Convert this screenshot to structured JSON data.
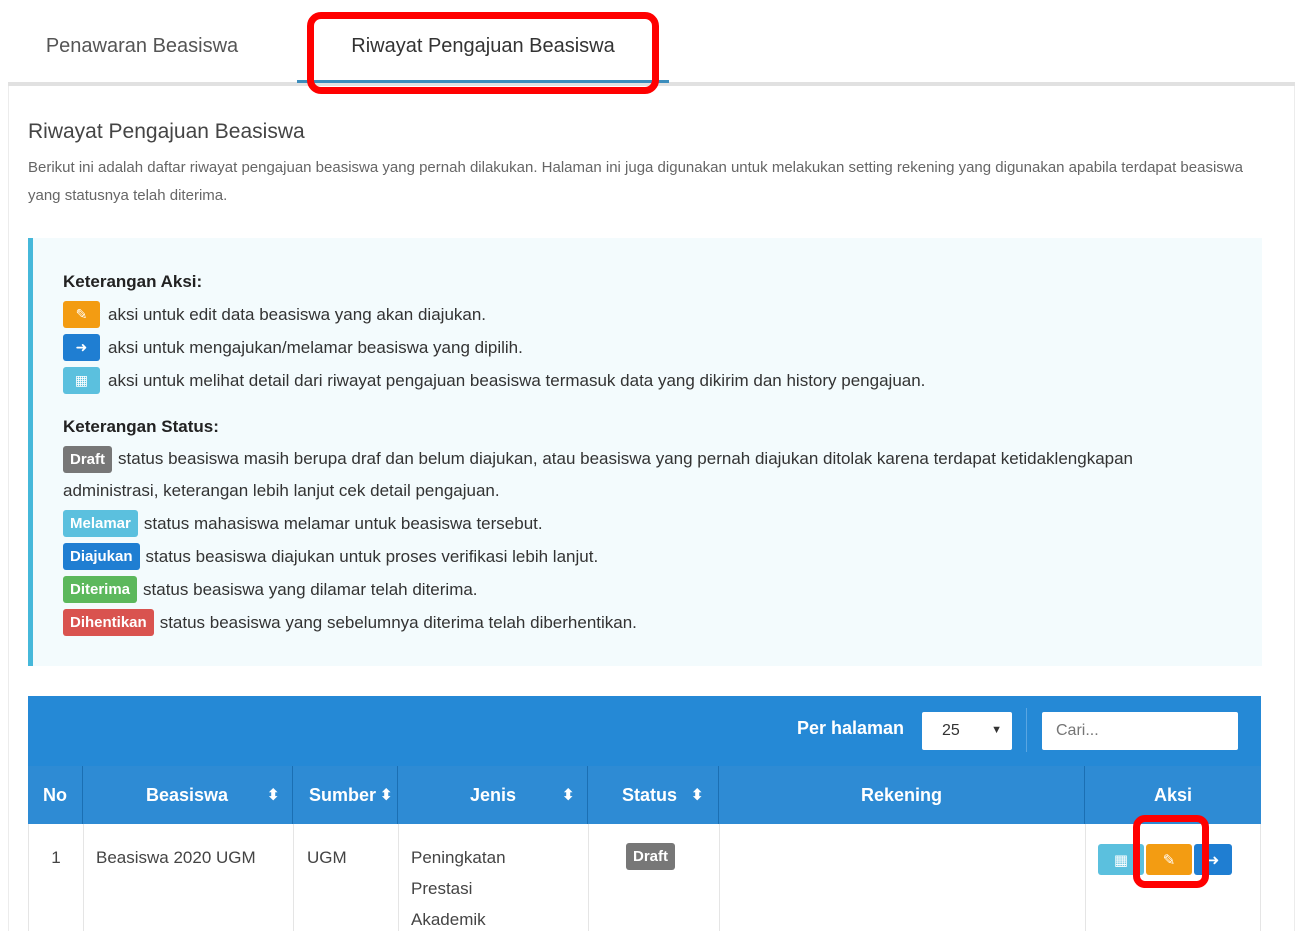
{
  "tabs": [
    {
      "label": "Penawaran Beasiswa"
    },
    {
      "label": "Riwayat Pengajuan Beasiswa"
    }
  ],
  "page": {
    "title": "Riwayat Pengajuan Beasiswa",
    "description": "Berikut ini adalah daftar riwayat pengajuan beasiswa yang pernah dilakukan. Halaman ini juga digunakan untuk melakukan setting rekening yang digunakan apabila terdapat beasiswa yang statusnya telah diterima."
  },
  "legend": {
    "aksi_title": "Keterangan Aksi:",
    "aksi": [
      {
        "icon": "edit-icon",
        "text": "aksi untuk edit data beasiswa yang akan diajukan."
      },
      {
        "icon": "arrow-right-icon",
        "text": "aksi untuk mengajukan/melamar beasiswa yang dipilih."
      },
      {
        "icon": "table-icon",
        "text": "aksi untuk melihat detail dari riwayat pengajuan beasiswa termasuk data yang dikirim dan history pengajuan."
      }
    ],
    "status_title": "Keterangan Status:",
    "status": [
      {
        "badge": "Draft",
        "text": "status beasiswa masih berupa draf dan belum diajukan, atau beasiswa yang pernah diajukan ditolak karena terdapat ketidaklengkapan administrasi, keterangan lebih lanjut cek detail pengajuan.",
        "color": "#777777"
      },
      {
        "badge": "Melamar",
        "text": "status mahasiswa melamar untuk beasiswa tersebut.",
        "color": "#5bc0de"
      },
      {
        "badge": "Diajukan",
        "text": "status beasiswa diajukan untuk proses verifikasi lebih lanjut.",
        "color": "#1f7ed2"
      },
      {
        "badge": "Diterima",
        "text": "status beasiswa yang dilamar telah diterima.",
        "color": "#5cb85c"
      },
      {
        "badge": "Dihentikan",
        "text": "status beasiswa yang sebelumnya diterima telah diberhentikan.",
        "color": "#d9534f"
      }
    ]
  },
  "toolbar": {
    "per_page_label": "Per halaman",
    "per_page_value": "25",
    "search_placeholder": "Cari..."
  },
  "table": {
    "headers": [
      "No",
      "Beasiswa",
      "Sumber",
      "Jenis",
      "Status",
      "Rekening",
      "Aksi"
    ],
    "rows": [
      {
        "no": "1",
        "beasiswa": "Beasiswa 2020 UGM",
        "sumber": "UGM",
        "jenis": "Peningkatan Prestasi Akademik",
        "status": "Draft",
        "rekening": ""
      }
    ]
  },
  "colors": {
    "primary": "#2589d6",
    "highlight": "#ff0000"
  }
}
